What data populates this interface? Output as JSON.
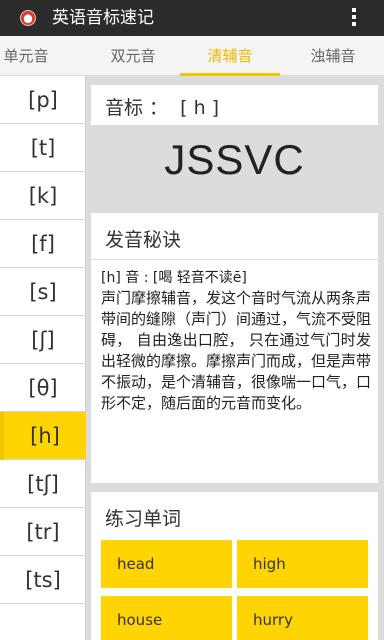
{
  "app": {
    "title": "英语音标速记",
    "icon": "app-logo-icon",
    "overflow_icon": "more-vert-icon"
  },
  "tabs": [
    {
      "label": "单元音"
    },
    {
      "label": "双元音"
    },
    {
      "label": "清辅音",
      "active": true
    },
    {
      "label": "浊辅音"
    }
  ],
  "symbols": [
    {
      "label": "[p]"
    },
    {
      "label": "[t]"
    },
    {
      "label": "[k]"
    },
    {
      "label": "[f]"
    },
    {
      "label": "[s]"
    },
    {
      "label": "[ʃ]"
    },
    {
      "label": "[θ]"
    },
    {
      "label": "[h]",
      "active": true
    },
    {
      "label": "[tʃ]"
    },
    {
      "label": "[tr]"
    },
    {
      "label": "[ts]"
    }
  ],
  "detail": {
    "phonetic_label": "音标 ：  [ h ]",
    "big_text": "JSSVC",
    "tips_title": "发音秘诀",
    "tips_subtitle": "[h] 音 : [喝 轻音不读ē]",
    "tips_body": "声门摩擦辅音，发这个音时气流从两条声带间的缝隙（声门）间通过，气流不受阻碍， 自由逸出口腔， 只在通过气门时发出轻微的摩擦。摩擦声门而成，但是声带不振动，是个清辅音，很像喘一口气，口形不定，随后面的元音而变化。",
    "practice_title": "练习单词",
    "words": [
      "head",
      "high",
      "house",
      "hurry"
    ]
  },
  "colors": {
    "accent": "#f3c400",
    "button": "#ffd400",
    "appbar": "#2b2b2b",
    "tab_active_text": "#f0b800"
  }
}
